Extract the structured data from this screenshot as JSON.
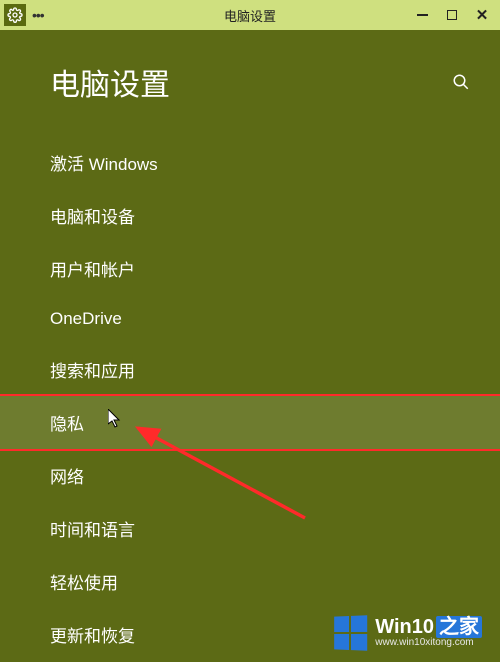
{
  "titlebar": {
    "title": "电脑设置"
  },
  "header": {
    "title": "电脑设置"
  },
  "nav": {
    "items": [
      {
        "label": "激活 Windows",
        "highlight": false
      },
      {
        "label": "电脑和设备",
        "highlight": false
      },
      {
        "label": "用户和帐户",
        "highlight": false
      },
      {
        "label": "OneDrive",
        "highlight": false
      },
      {
        "label": "搜索和应用",
        "highlight": false
      },
      {
        "label": "隐私",
        "highlight": true
      },
      {
        "label": "网络",
        "highlight": false
      },
      {
        "label": "时间和语言",
        "highlight": false
      },
      {
        "label": "轻松使用",
        "highlight": false
      },
      {
        "label": "更新和恢复",
        "highlight": false
      }
    ]
  },
  "watermark": {
    "brand": "Win10",
    "suffix": "之家",
    "url": "www.win10xitong.com"
  }
}
